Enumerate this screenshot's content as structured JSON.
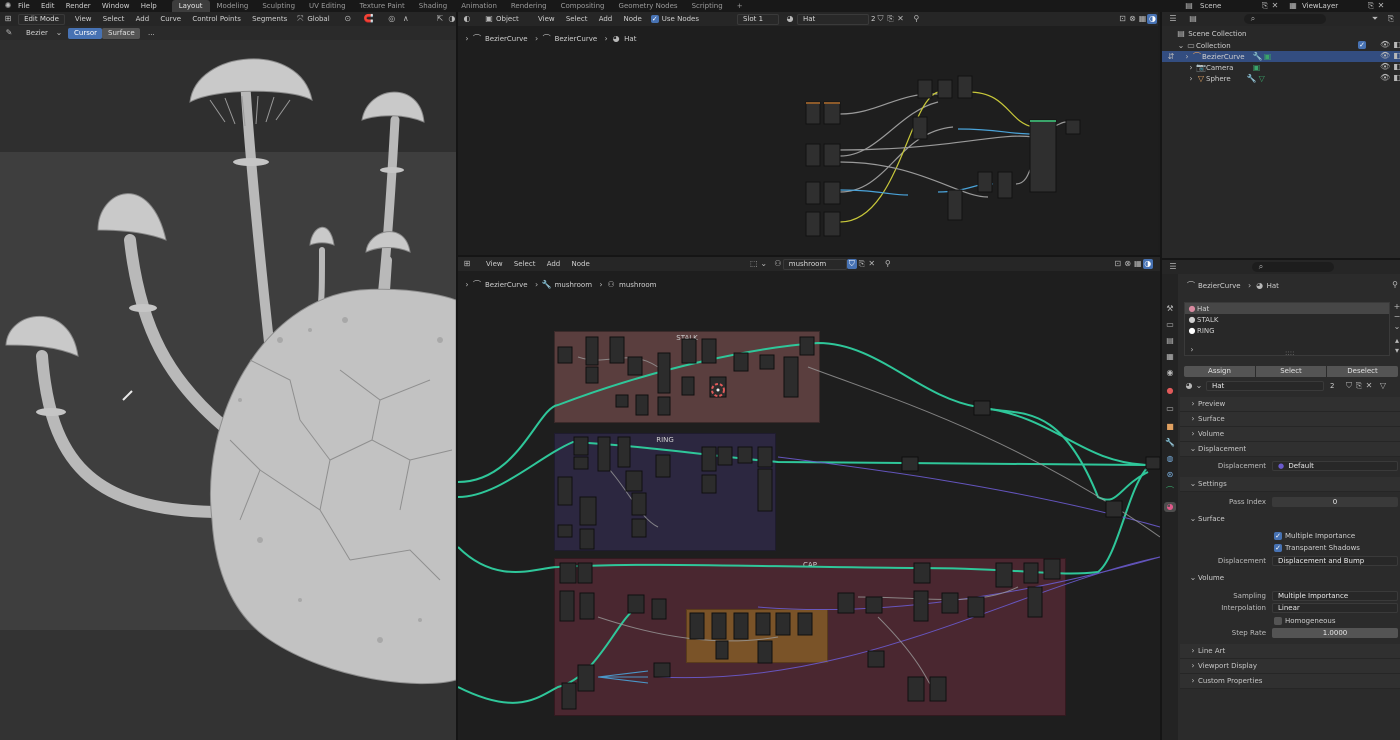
{
  "topbar": {
    "menus": [
      "File",
      "Edit",
      "Render",
      "Window",
      "Help"
    ],
    "workspaces": [
      "Layout",
      "Modeling",
      "Sculpting",
      "UV Editing",
      "Texture Paint",
      "Shading",
      "Animation",
      "Rendering",
      "Compositing",
      "Geometry Nodes",
      "Scripting"
    ],
    "active_workspace": "Layout",
    "add_tab": "+",
    "scene": "Scene",
    "view_layer": "ViewLayer"
  },
  "viewport": {
    "mode": "Edit Mode",
    "menus": [
      "View",
      "Select",
      "Add",
      "Curve",
      "Control Points",
      "Segments"
    ],
    "transform": "Global",
    "tool_label": "Bezier",
    "tool_cursor": "Cursor",
    "tool_surface": "Surface",
    "tool_more": "..."
  },
  "node_editor_top": {
    "object_type": "Object",
    "menus": [
      "View",
      "Select",
      "Add",
      "Node"
    ],
    "use_nodes_label": "Use Nodes",
    "slot": "Slot 1",
    "material": "Hat",
    "users": "2",
    "breadcrumbs": [
      "BezierCurve",
      "BezierCurve",
      "Hat"
    ]
  },
  "node_editor_bottom": {
    "menus": [
      "View",
      "Select",
      "Add",
      "Node"
    ],
    "group_name": "mushroom",
    "breadcrumbs": [
      "BezierCurve",
      "mushroom",
      "mushroom"
    ],
    "frames": [
      "STALK",
      "RING",
      "CAP"
    ]
  },
  "outliner": {
    "scene_collection": "Scene Collection",
    "items": [
      {
        "name": "Collection",
        "indent": 1
      },
      {
        "name": "BezierCurve",
        "indent": 2
      },
      {
        "name": "Camera",
        "indent": 2
      },
      {
        "name": "Sphere",
        "indent": 2
      }
    ]
  },
  "properties": {
    "breadcrumb": [
      "BezierCurve",
      "Hat"
    ],
    "material_slots": [
      "Hat",
      "STALK",
      "RING"
    ],
    "assign": "Assign",
    "select": "Select",
    "deselect": "Deselect",
    "material_name": "Hat",
    "material_users": "2",
    "sections": {
      "preview": "Preview",
      "surface": "Surface",
      "volume": "Volume",
      "displacement": "Displacement",
      "settings": "Settings",
      "line_art": "Line Art",
      "viewport_display": "Viewport Display",
      "custom_properties": "Custom Properties"
    },
    "displacement_label": "Displacement",
    "displacement_value": "Default",
    "pass_index_label": "Pass Index",
    "pass_index_value": "0",
    "surface_sub": "Surface",
    "multiple_importance": "Multiple Importance",
    "transparent_shadows": "Transparent Shadows",
    "displacement_method_label": "Displacement",
    "displacement_method": "Displacement and Bump",
    "volume_sub": "Volume",
    "sampling_label": "Sampling",
    "sampling_value": "Multiple Importance",
    "interpolation_label": "Interpolation",
    "interpolation_value": "Linear",
    "homogeneous": "Homogeneous",
    "step_rate_label": "Step Rate",
    "step_rate_value": "1.0000"
  },
  "colors": {
    "accent": "#4772b3",
    "stalk_frame": "#5a3e3e",
    "ring_frame": "#2c2740",
    "cap_frame": "#4a2730",
    "wire_teal": "#2fc79a",
    "wire_purple": "#6a5acd",
    "wire_yellow": "#c8c83a"
  }
}
